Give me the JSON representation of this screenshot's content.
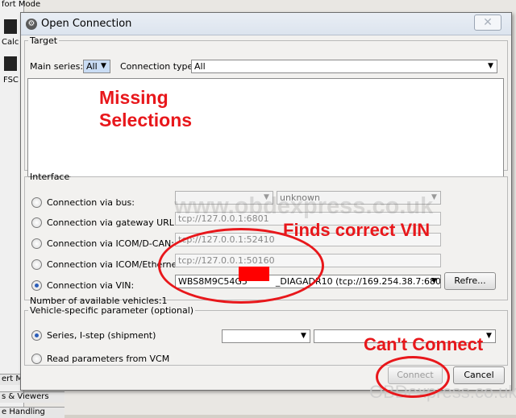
{
  "background": {
    "top_label": "fort Mode",
    "icon_label_1": "Calc",
    "icon_label_2": "FSC",
    "bottom_1": "ert M",
    "bottom_2": "s & Viewers",
    "bottom_3": "e Handling"
  },
  "window": {
    "title": "Open Connection",
    "close_glyph": "✕"
  },
  "target": {
    "legend": "Target",
    "main_series_label": "Main series:",
    "main_series_value": "All",
    "connection_type_label": "Connection type:",
    "connection_type_value": "All"
  },
  "interface": {
    "legend": "Interface",
    "rows": [
      {
        "label": "Connection via bus:",
        "selected": false
      },
      {
        "label": "Connection via gateway URL:",
        "selected": false,
        "value": "tcp://127.0.0.1:6801"
      },
      {
        "label": "Connection via ICOM/D-CAN:",
        "selected": false,
        "value": "tcp://127.0.0.1:52410"
      },
      {
        "label": "Connection via ICOM/Ethernet:",
        "selected": false,
        "value": "tcp://127.0.0.1:50160"
      },
      {
        "label": "Connection via VIN:",
        "selected": true,
        "value_start": "WBS8M9C54G5",
        "value_end": "_DIAGADR10 (tcp://169.254.38.7:6801)"
      }
    ],
    "bus_value_2": "unknown",
    "refresh_label": "Refre...",
    "available_vehicles": "Number of available vehicles:1"
  },
  "vehicle_params": {
    "legend": "Vehicle-specific parameter (optional)",
    "option_1": "Series, I-step (shipment)",
    "option_2": "Read parameters from VCM"
  },
  "buttons": {
    "connect": "Connect",
    "cancel": "Cancel"
  },
  "annotations": {
    "missing_1": "Missing",
    "missing_2": "Selections",
    "finds_vin": "Finds correct VIN",
    "cant_connect": "Can't Connect"
  },
  "watermarks": {
    "center": "www.obdexpress.co.uk",
    "corner": "OBDexpress.co.uk"
  },
  "colors": {
    "annotation_red": "#e8171b",
    "radio_selected": "#2b5db8",
    "redaction": "#ff0000"
  }
}
